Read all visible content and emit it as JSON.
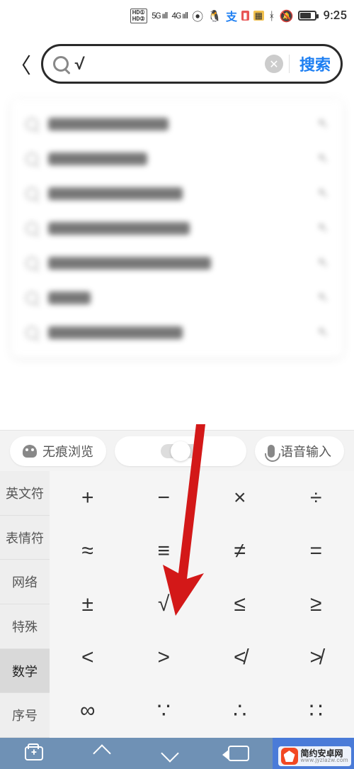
{
  "status": {
    "hd1": "HD①",
    "hd2": "HD②",
    "net1": "5G",
    "net2": "4G",
    "time": "9:25"
  },
  "search": {
    "query_text": "√",
    "action_label": "搜索"
  },
  "suggestions_widths": [
    170,
    140,
    190,
    200,
    230,
    60,
    190
  ],
  "toolbar": {
    "incognito": "无痕浏览",
    "voice": "语音输入"
  },
  "keyboard": {
    "tabs": [
      "英文符",
      "表情符",
      "网络",
      "特殊",
      "数学",
      "序号"
    ],
    "active_tab_index": 4,
    "keys": [
      "+",
      "−",
      "×",
      "÷",
      "≈",
      "≡",
      "≠",
      "=",
      "±",
      "√",
      "≤",
      "≥",
      "<",
      ">",
      "≮",
      "≯",
      "∞",
      "∵",
      "∴",
      "∷"
    ]
  },
  "watermark": {
    "title": "简约安卓网",
    "url": "www.jyzlazw.com"
  }
}
